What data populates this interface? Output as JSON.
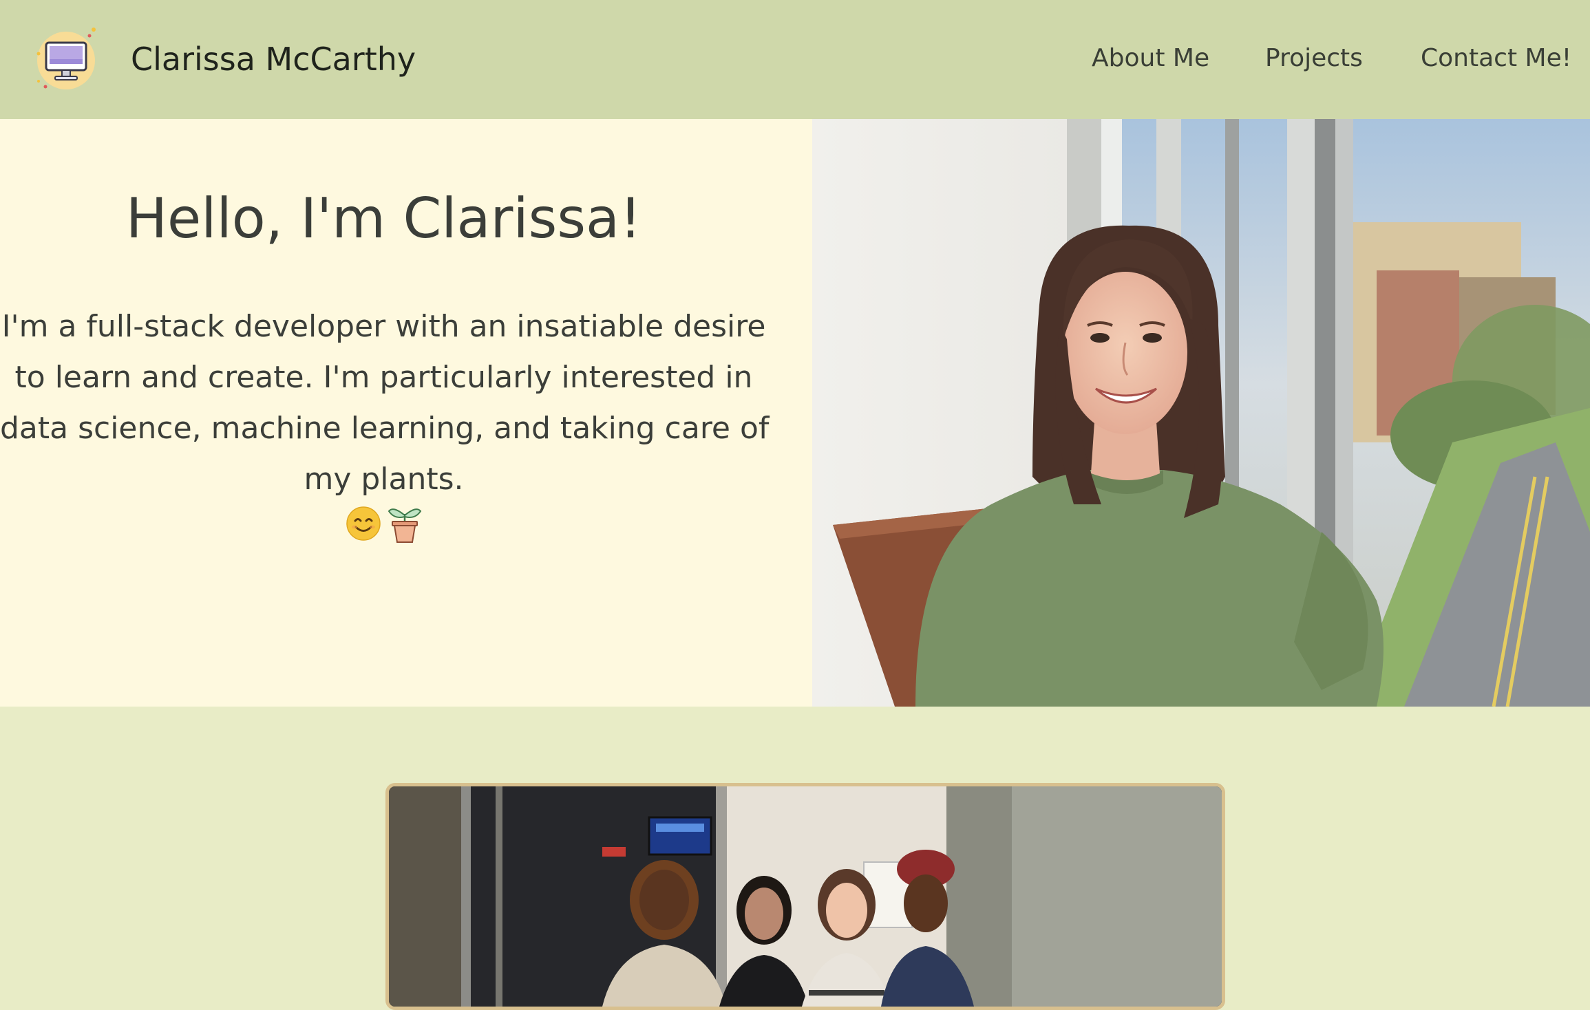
{
  "header": {
    "brand_name": "Clarissa McCarthy",
    "logo_icon": "desktop-computer-icon",
    "nav": [
      {
        "label": "About Me"
      },
      {
        "label": "Projects"
      },
      {
        "label": "Contact Me!"
      }
    ]
  },
  "hero": {
    "title": "Hello, I'm Clarissa!",
    "description_lines": [
      "I'm a full-stack developer with an insatiable desire",
      "to learn and create. I'm particularly interested in",
      "data science, machine learning, and taking care of",
      "my plants."
    ],
    "emojis": [
      "smiling-face-icon",
      "potted-plant-icon"
    ]
  },
  "colors": {
    "header_bg": "#cfd8aa",
    "hero_bg": "#fef9df",
    "page_bg": "#e8ecc6",
    "photo_border": "#d8c08e",
    "text": "#3b3e39"
  }
}
